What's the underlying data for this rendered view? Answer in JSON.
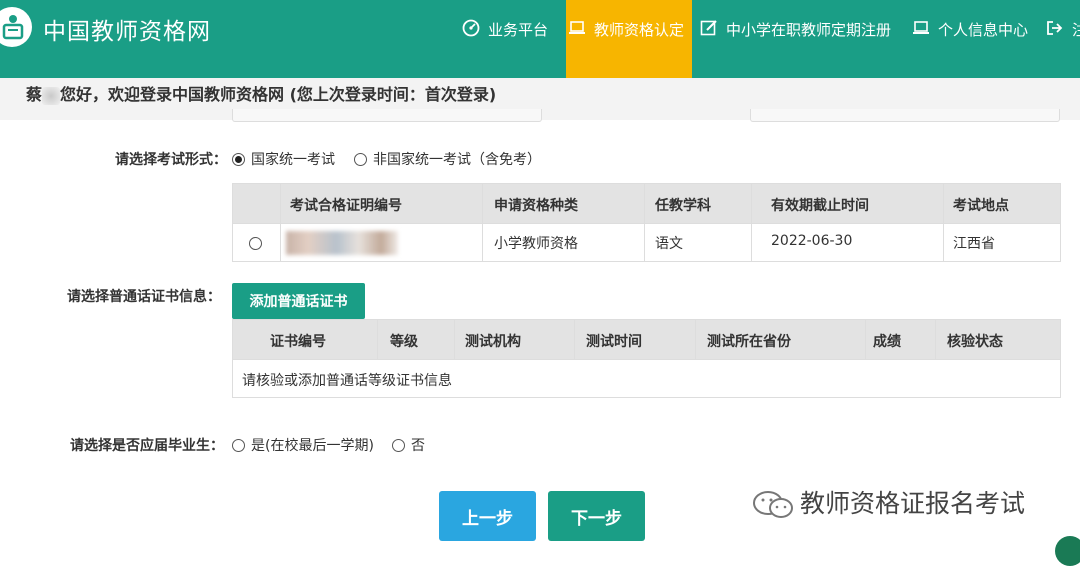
{
  "header": {
    "site_title": "中国教师资格网",
    "nav": [
      {
        "label": "业务平台",
        "icon": "dashboard-icon"
      },
      {
        "label": "教师资格认定",
        "icon": "laptop-icon",
        "active": true
      },
      {
        "label": "中小学在职教师定期注册",
        "icon": "edit-icon"
      },
      {
        "label": "个人信息中心",
        "icon": "laptop-icon"
      },
      {
        "label": "注",
        "icon": "logout-icon"
      }
    ],
    "colors": {
      "primary": "#1a9e86",
      "active": "#f7b500"
    }
  },
  "welcome": {
    "name_prefix": "蔡",
    "text": "您好，欢迎登录中国教师资格网 (您上次登录时间：首次登录)"
  },
  "exam_form": {
    "label": "请选择考试形式：",
    "options": [
      "国家统一考试",
      "非国家统一考试（含免考）"
    ],
    "selected": "国家统一考试"
  },
  "exam_table": {
    "headers": [
      "考试合格证明编号",
      "申请资格种类",
      "任教学科",
      "有效期截止时间",
      "考试地点"
    ],
    "rows": [
      {
        "cert_no": "",
        "type": "小学教师资格",
        "subject": "语文",
        "expiry": "2022-06-30",
        "place": "江西省"
      }
    ]
  },
  "mandarin": {
    "label": "请选择普通话证书信息：",
    "add_button": "添加普通话证书",
    "headers": [
      "证书编号",
      "等级",
      "测试机构",
      "测试时间",
      "测试所在省份",
      "成绩",
      "核验状态"
    ],
    "empty_message": "请核验或添加普通话等级证书信息"
  },
  "graduate": {
    "label": "请选择是否应届毕业生：",
    "options": [
      "是(在校最后一学期)",
      "否"
    ]
  },
  "buttons": {
    "prev": "上一步",
    "next": "下一步"
  },
  "watermark": "教师资格证报名考试"
}
